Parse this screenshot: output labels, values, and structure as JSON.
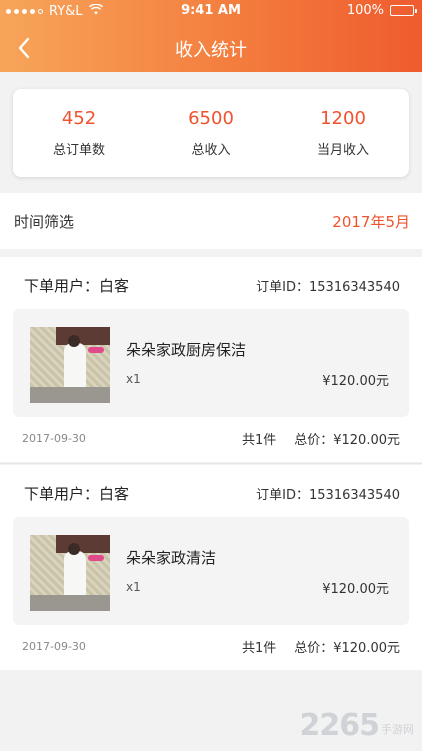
{
  "status_bar": {
    "carrier": "RY&L",
    "time": "9:41 AM",
    "battery": "100%",
    "signal_icon": "signal-dots-icon",
    "wifi_icon": "wifi-icon"
  },
  "nav": {
    "title": "收入统计",
    "back_icon": "chevron-left-icon"
  },
  "stats": [
    {
      "value": "452",
      "label": "总订单数"
    },
    {
      "value": "6500",
      "label": "总收入"
    },
    {
      "value": "1200",
      "label": "当月收入"
    }
  ],
  "filter": {
    "label": "时间筛选",
    "value": "2017年5月"
  },
  "orders": [
    {
      "user": "下单用户：白客",
      "order_id": "订单ID：15316343540",
      "item_name": "朵朵家政厨房保洁",
      "qty": "x1",
      "price": "¥120.00元",
      "date": "2017-09-30",
      "count": "共1件",
      "total": "总价：¥120.00元"
    },
    {
      "user": "下单用户：白客",
      "order_id": "订单ID：15316343540",
      "item_name": "朵朵家政清洁",
      "qty": "x1",
      "price": "¥120.00元",
      "date": "2017-09-30",
      "count": "共1件",
      "total": "总价：¥120.00元"
    }
  ],
  "watermark": {
    "number": "2265",
    "text": "手游网"
  },
  "colors": {
    "accent": "#f0522e",
    "header_start": "#f7a55a",
    "header_end": "#ef5b2e"
  }
}
